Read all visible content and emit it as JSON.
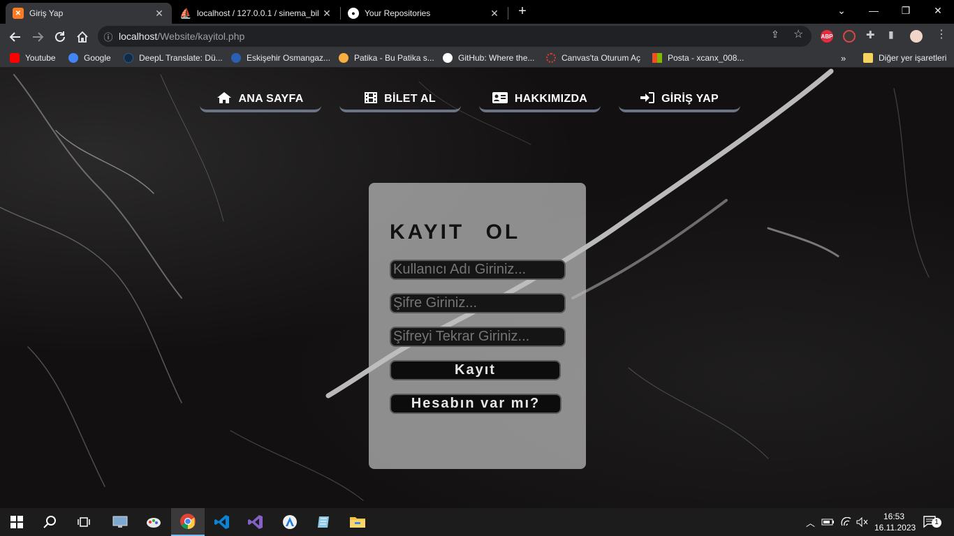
{
  "browser": {
    "tabs": [
      {
        "title": "Giriş Yap",
        "icon": "xampp-icon",
        "active": true
      },
      {
        "title": "localhost / 127.0.0.1 / sinema_bil",
        "icon": "phpmyadmin-icon",
        "active": false
      },
      {
        "title": "Your Repositories",
        "icon": "github-icon",
        "active": false
      }
    ],
    "url_host": "localhost",
    "url_path": "/Website/kayitol.php",
    "bookmarks": [
      {
        "label": "Youtube",
        "color": "#ff0000"
      },
      {
        "label": "Google",
        "color": "#4285f4"
      },
      {
        "label": "DeepL Translate: Dü...",
        "color": "#0f2b46"
      },
      {
        "label": "Eskişehir Osmangaz...",
        "color": "#2b5fb5"
      },
      {
        "label": "Patika - Bu Patika s...",
        "color": "#f5b041"
      },
      {
        "label": "GitHub: Where the...",
        "color": "#ffffff"
      },
      {
        "label": "Canvas'ta Oturum Aç",
        "color": "#e13c2b"
      },
      {
        "label": "Posta - xcanx_008...",
        "color": "#f25022"
      }
    ],
    "other_bookmarks": "Diğer yer işaretleri",
    "extension_abp": "ABP"
  },
  "nav": [
    {
      "label": "ANA SAYFA",
      "icon": "home-icon"
    },
    {
      "label": "BİLET AL",
      "icon": "film-icon"
    },
    {
      "label": "HAKKIMIZDA",
      "icon": "id-card-icon"
    },
    {
      "label": "GİRİŞ YAP",
      "icon": "sign-in-icon"
    }
  ],
  "form": {
    "title": "KAYIT OL",
    "username_placeholder": "Kullanıcı Adı Giriniz...",
    "password_placeholder": "Şifre Giriniz...",
    "password_repeat_placeholder": "Şifreyi Tekrar Giriniz...",
    "submit_label": "Kayıt",
    "login_link_label": "Hesabın var mı?"
  },
  "taskbar": {
    "time": "16:53",
    "date": "16.11.2023",
    "notification_count": "1"
  }
}
